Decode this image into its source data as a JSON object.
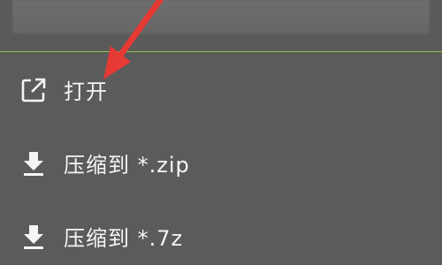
{
  "menu": {
    "items": [
      {
        "label": "打开",
        "icon": "open-external-icon"
      },
      {
        "label": "压缩到 *.zip",
        "icon": "download-icon"
      },
      {
        "label": "压缩到 *.7z",
        "icon": "download-icon"
      }
    ]
  },
  "colors": {
    "background": "#5b5b5b",
    "divider": "#8bc34a",
    "text": "#f5f5f5",
    "annotation_arrow": "#e53935"
  }
}
